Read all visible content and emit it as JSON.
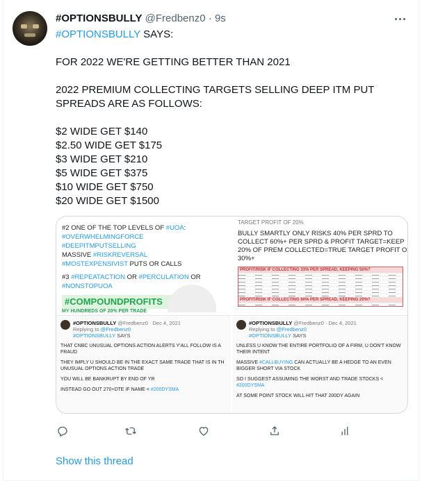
{
  "tweet": {
    "author_name": "#OPTIONSBULLY",
    "author_handle": "@Fredbenz0",
    "dot": "·",
    "time": "9s",
    "hashtag_line_tag": "#OPTIONSBULLY",
    "hashtag_line_rest": " SAYS:",
    "line_1": "FOR 2022 WE'RE GETTING BETTER THAN 2021",
    "line_2": "2022 PREMIUM COLLECTING TARGETS SELLING DEEP ITM PUT",
    "line_3": "SPREADS ARE AS FOLLOWS:",
    "targets": [
      "$2 WIDE GET $140",
      "$2.50 WIDE GET $175",
      "$3 WIDE GET $210",
      "$5 WIDE GET $375",
      "$10 WIDE GET $750",
      "$20 WIDE GET $1500"
    ]
  },
  "media": {
    "tile1": {
      "l1a": "#2 ONE OF THE TOP LEVELS OF ",
      "l1b": "#UOA",
      "l2": "#OVERWHELMINGFORCE",
      "l3": "#DEEPITMPUTSELLING",
      "l4a": "MASSIVE ",
      "l4b": "#RISKREVERSAL",
      "l5a": "#MOSTEXPENSIVIST",
      "l5b": " PUTS OR CALLS",
      "l6a": "#3 ",
      "l6b": "#REPEATACTION",
      "l6c": " OR ",
      "l6d": "#PERCULATION",
      "l6e": " OR",
      "l7": "#NONSTOPUOA",
      "banner": "#COMPOUNDPROFITS",
      "banner_sub": "MY HUNDREDS OF 20% PER TRADE"
    },
    "tile2": {
      "top": "TARGET PROFIT OF 20%",
      "l1": "BULLY SMARTLY ONLY RISKS 40% PER SPRD TO",
      "l2": "COLLECT 60%+ PER SPRD & PROFIT TARGET=KEEP",
      "l3": "20% OF PREM COLLECTED=TRUE TARGET PROFIT OF",
      "l4": "30%+",
      "table1": "PROFIT/RISK IF COLLECTING 33% PER SPREAD, KEEPING 50%?",
      "table2": "PROFIT/RISK IF COLLECTING 60% PER SPREAD, KEEPING 20%?"
    },
    "tile3": {
      "name": "#OPTIONSBULLY",
      "handle": "@Fredbenz0",
      "date": "· Dec 4, 2021",
      "replying_label": "Replying to ",
      "replying_to": "@Fredbenz0",
      "tag": "#OPTIONSBULLY",
      "says": " SAYS",
      "p1": "THAT CNBC UNUSUAL OPTIONS ACTION ALERTS Y'ALL FOLLOW IS A FRAUD",
      "p2": "THEY IMPLY U SHOULD BE IN THE EXACT SAME TRADE THAT IS IN TH UNUSUAL OPTIONS ACTION TRADE",
      "p3": "YOU WILL BE BANKRUPT BY END OF YR",
      "p4a": "INSTEAD GO OUT 270+DTE IF NAME < ",
      "p4b": "#200DYSMA"
    },
    "tile4": {
      "name": "#OPTIONSBULLY",
      "handle": "@Fredbenz0",
      "date": "· Dec 4, 2021",
      "replying_label": "Replying to ",
      "replying_to": "@Fredbenz0",
      "tag": "#OPTIONSBULLY",
      "says": " SAYS",
      "p1": "UNLESS U KNOW THE ENTIRE PORTFOLIO OF A FIRM, U DON'T KNOW THEIR INTENT",
      "p2a": "MASSIVE ",
      "p2b": "#CALLBUYING",
      "p2c": " CAN ACTUALLY BE A HEDGE TO AN EVEN BIGGER SHORT VIA STOCK",
      "p3a": "SO I SUGGEST ASSUMING THE WORST AND TRADE STOCKS < ",
      "p3b": "#200DYSMA",
      "p4": "AT SOME POINT STOCK WILL HIT THAT 200DY AGAIN"
    }
  },
  "actions": {
    "reply_icon": "reply-icon",
    "retweet_icon": "retweet-icon",
    "like_icon": "heart-icon",
    "share_icon": "share-icon",
    "analytics_icon": "analytics-icon"
  },
  "show_thread": "Show this thread",
  "colors": {
    "link": "#1d9bf0",
    "muted": "#536471",
    "text": "#0f1419",
    "green": "#1ea64c",
    "red": "#c42e2e"
  }
}
